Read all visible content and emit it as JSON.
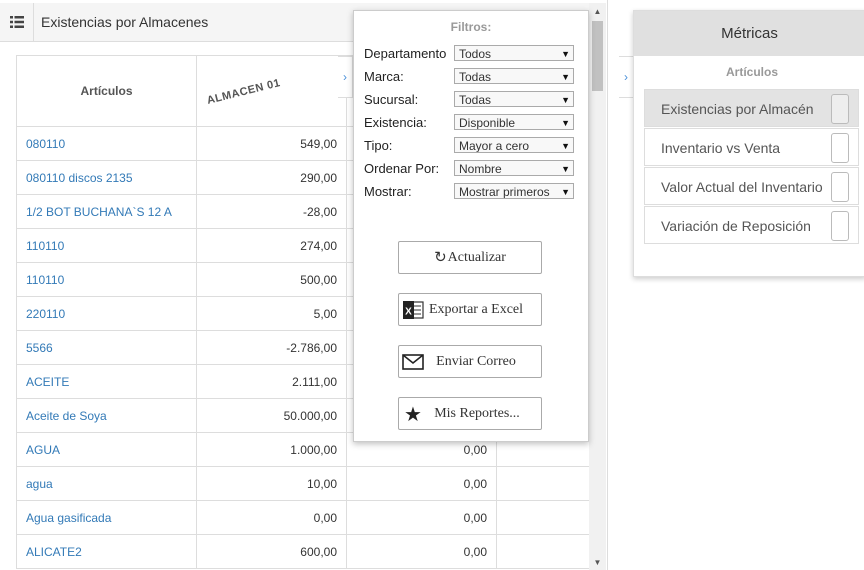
{
  "header": {
    "title": "Existencias por Almacenes",
    "menu_icon": "list-icon"
  },
  "table": {
    "columns": [
      "Artículos",
      "ALMACEN 01"
    ],
    "rows": [
      {
        "name": "080110",
        "almacen01": "549,00",
        "col3": "",
        "col4": ""
      },
      {
        "name": "080110 discos 2135",
        "almacen01": "290,00",
        "col3": "",
        "col4": ""
      },
      {
        "name": "1/2 BOT BUCHANA`S 12 A",
        "almacen01": "-28,00",
        "col3": "",
        "col4": ""
      },
      {
        "name": "110110",
        "almacen01": "274,00",
        "col3": "",
        "col4": ""
      },
      {
        "name": "110110",
        "almacen01": "500,00",
        "col3": "",
        "col4": ""
      },
      {
        "name": "220110",
        "almacen01": "5,00",
        "col3": "",
        "col4": ""
      },
      {
        "name": "5566",
        "almacen01": "-2.786,00",
        "col3": "",
        "col4": ""
      },
      {
        "name": "ACEITE",
        "almacen01": "2.111,00",
        "col3": "",
        "col4": ""
      },
      {
        "name": "Aceite de Soya",
        "almacen01": "50.000,00",
        "col3": "",
        "col4": ""
      },
      {
        "name": "AGUA",
        "almacen01": "1.000,00",
        "col3": "0,00",
        "col4": ""
      },
      {
        "name": "agua",
        "almacen01": "10,00",
        "col3": "0,00",
        "col4": ""
      },
      {
        "name": "Agua gasificada",
        "almacen01": "0,00",
        "col3": "0,00",
        "col4": ""
      },
      {
        "name": "ALICATE2",
        "almacen01": "600,00",
        "col3": "0,00",
        "col4": ""
      }
    ]
  },
  "filters": {
    "title": "Filtros:",
    "fields": [
      {
        "label": "Departamento",
        "value": "Todos"
      },
      {
        "label": "Marca:",
        "value": "Todas"
      },
      {
        "label": "Sucursal:",
        "value": "Todas"
      },
      {
        "label": "Existencia:",
        "value": "Disponible"
      },
      {
        "label": "Tipo:",
        "value": "Mayor a cero"
      },
      {
        "label": "Ordenar Por:",
        "value": "Nombre"
      },
      {
        "label": "Mostrar:",
        "value": "Mostrar primeros"
      }
    ],
    "buttons": {
      "refresh": "Actualizar",
      "excel": "Exportar a Excel",
      "email": "Enviar Correo",
      "reports": "Mis Reportes..."
    }
  },
  "metrics": {
    "title": "Métricas",
    "subtitle": "Artículos",
    "items": [
      {
        "label": "Existencias por Almacén",
        "active": true
      },
      {
        "label": "Inventario vs Venta",
        "active": false
      },
      {
        "label": "Valor Actual del Inventario",
        "active": false
      },
      {
        "label": "Variación de Reposición",
        "active": false
      }
    ]
  }
}
